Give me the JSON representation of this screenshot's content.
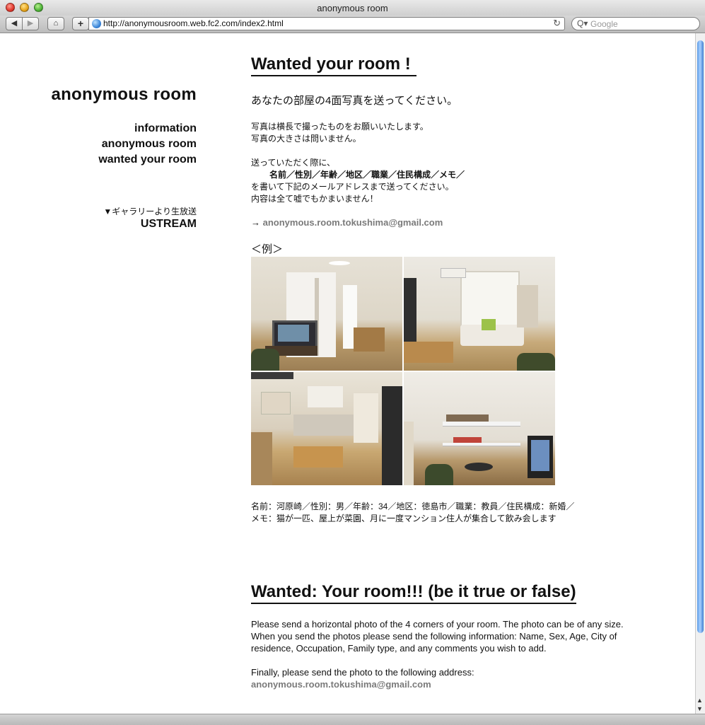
{
  "window": {
    "title": "anonymous room"
  },
  "toolbar": {
    "back_glyph": "◀",
    "forward_glyph": "▶",
    "home_glyph": "⌂",
    "add_glyph": "+",
    "url": "http://anonymousroom.web.fc2.com/index2.html",
    "reload_glyph": "↻",
    "search_placeholder": "Google",
    "search_glyph": "Q▾"
  },
  "sidebar": {
    "site_title": "anonymous room",
    "nav": [
      "information",
      "anonymous room",
      "wanted your room"
    ],
    "gallery_note": "▼ギャラリーより生放送",
    "ustream": "USTREAM"
  },
  "main": {
    "heading_jp": "Wanted your room !",
    "lead_jp": "あなたの部屋の4面写真を送ってください。",
    "para1_line1": "写真は横長で撮ったものをお願いいたします。",
    "para1_line2": "写真の大きさは問いません。",
    "para2_line1": "送っていただく際に、",
    "para2_line2": "名前／性別／年齢／地区／職業／住民構成／メモ／",
    "para2_line3": "を書いて下記のメールアドレスまで送ってください。",
    "para2_line4": "内容は全て嘘でもかまいません！",
    "email_arrow": "→",
    "email": "anonymous.room.tokushima@gmail.com",
    "example_label": "＜例＞",
    "caption_line1": "名前：河原崎／性別：男／年齢：34／地区：徳島市／職業：教員／住民構成：新婚／",
    "caption_line2": "メモ：猫が一匹、屋上が菜園、月に一度マンション住人が集合して飲み会します",
    "heading_en": "Wanted: Your room!!! (be it true or false)",
    "en_para1": "Please send a horizontal photo of the 4 corners of your room. The photo can be of any size. When you send the photos please send the following information: Name, Sex, Age, City of residence, Occupation, Family type, and any comments you wish to add.",
    "en_para2": "Finally, please send the photo to the following address:",
    "email_en": "anonymous.room.tokushima@gmail.com"
  },
  "scrollbar": {
    "up_glyph": "▲",
    "down_glyph": "▼"
  }
}
